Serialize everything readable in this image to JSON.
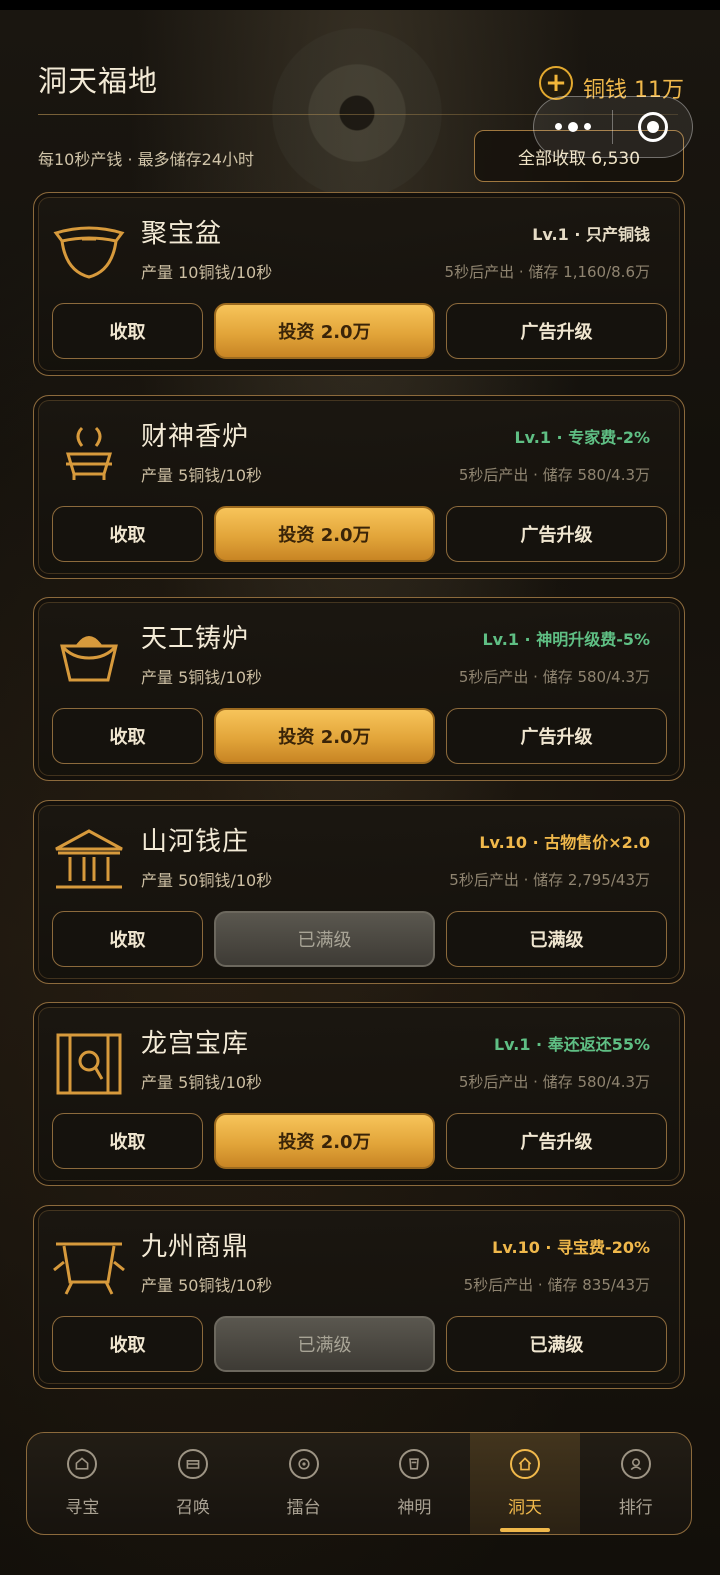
{
  "header": {
    "title": "洞天福地",
    "subtitle": "每10秒产钱 · 最多储存24小时",
    "currency_plus": "+",
    "currency_label": "铜钱 11万",
    "collect_all_label": "全部收取 6,530"
  },
  "colors": {
    "accent": "#f0b84b",
    "level_gold": "#f0b84b",
    "level_green": "#5fbf84"
  },
  "cards": [
    {
      "icon": "bowl-icon",
      "name": "聚宝盆",
      "rate": "产量 10铜钱/10秒",
      "tag": "Lv.1 · 只产铜钱",
      "tag_color": "neutral",
      "storage": "5秒后产出 · 储存 1,160/8.6万",
      "collect_label": "收取",
      "middle_label": "投资 2.0万",
      "middle_state": "invest",
      "right_label": "广告升级"
    },
    {
      "icon": "incense-burner-icon",
      "name": "财神香炉",
      "rate": "产量 5铜钱/10秒",
      "tag": "Lv.1 · 专家费-2%",
      "tag_color": "green",
      "storage": "5秒后产出 · 储存 580/4.3万",
      "collect_label": "收取",
      "middle_label": "投资 2.0万",
      "middle_state": "invest",
      "right_label": "广告升级"
    },
    {
      "icon": "furnace-icon",
      "name": "天工铸炉",
      "rate": "产量 5铜钱/10秒",
      "tag": "Lv.1 · 神明升级费-5%",
      "tag_color": "green",
      "storage": "5秒后产出 · 储存 580/4.3万",
      "collect_label": "收取",
      "middle_label": "投资 2.0万",
      "middle_state": "invest",
      "right_label": "广告升级"
    },
    {
      "icon": "bank-icon",
      "name": "山河钱庄",
      "rate": "产量 50铜钱/10秒",
      "tag": "Lv.10 · 古物售价×2.0",
      "tag_color": "gold",
      "storage": "5秒后产出 · 储存 2,795/43万",
      "collect_label": "收取",
      "middle_label": "已满级",
      "middle_state": "maxed",
      "right_label": "已满级"
    },
    {
      "icon": "vault-icon",
      "name": "龙宫宝库",
      "rate": "产量 5铜钱/10秒",
      "tag": "Lv.1 · 奉还返还55%",
      "tag_color": "green",
      "storage": "5秒后产出 · 储存 580/4.3万",
      "collect_label": "收取",
      "middle_label": "投资 2.0万",
      "middle_state": "invest",
      "right_label": "广告升级"
    },
    {
      "icon": "cauldron-icon",
      "name": "九州商鼎",
      "rate": "产量 50铜钱/10秒",
      "tag": "Lv.10 · 寻宝费-20%",
      "tag_color": "gold",
      "storage": "5秒后产出 · 储存 835/43万",
      "collect_label": "收取",
      "middle_label": "已满级",
      "middle_state": "maxed",
      "right_label": "已满级"
    }
  ],
  "nav": [
    {
      "label": "寻宝",
      "icon": "treasure-icon",
      "active": false
    },
    {
      "label": "召唤",
      "icon": "summon-icon",
      "active": false
    },
    {
      "label": "擂台",
      "icon": "arena-icon",
      "active": false
    },
    {
      "label": "神明",
      "icon": "deity-icon",
      "active": false
    },
    {
      "label": "洞天",
      "icon": "home-icon",
      "active": true
    },
    {
      "label": "排行",
      "icon": "ranking-icon",
      "active": false
    }
  ]
}
